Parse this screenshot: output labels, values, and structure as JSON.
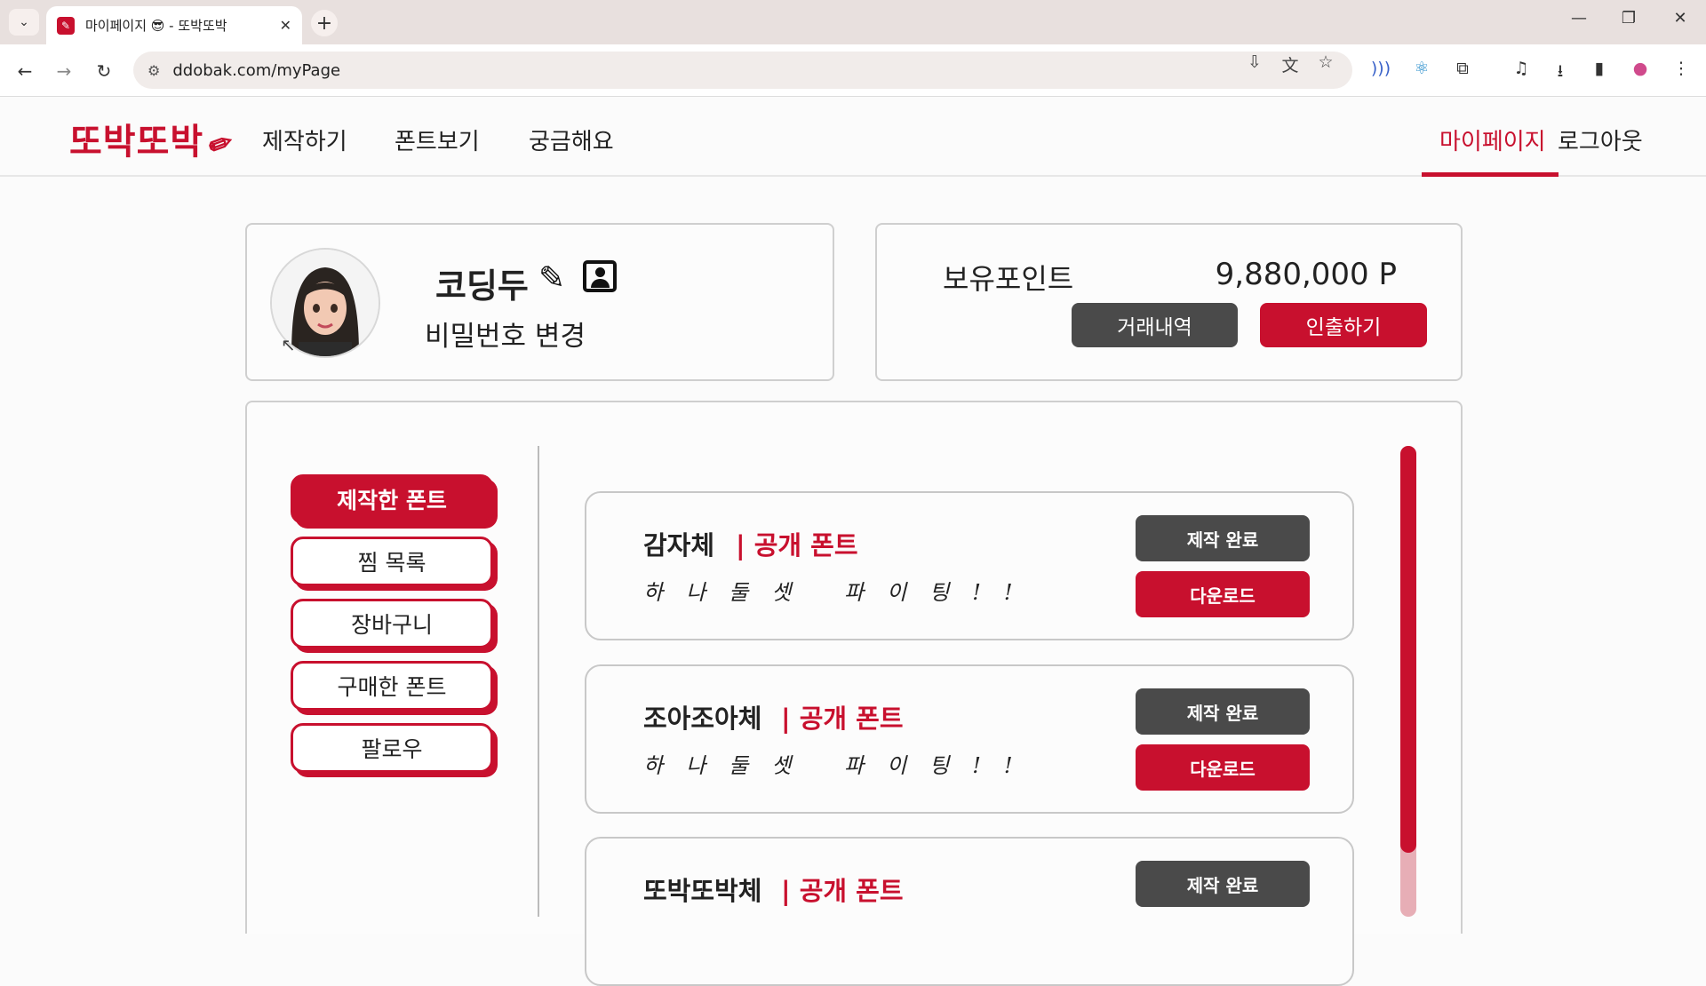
{
  "browser": {
    "tab_title": "마이페이지 😎 - 또박또박",
    "url_display": "ddobak.com/myPage",
    "icons": {
      "tab_search": "chevron-down-icon",
      "new_tab": "plus-icon",
      "close_tab": "close-icon",
      "back": "back-arrow-icon",
      "forward": "forward-arrow-icon",
      "reload": "reload-icon"
    }
  },
  "header": {
    "logo": "또박또박",
    "nav": [
      "제작하기",
      "폰트보기",
      "궁금해요"
    ],
    "mypage": "마이페이지",
    "logout": "로그아웃",
    "accent_color": "#c8102e"
  },
  "profile": {
    "nickname": "코딩두",
    "password_change": "비밀번호 변경"
  },
  "points": {
    "label": "보유포인트",
    "value": "9,880,000 P",
    "history_button": "거래내역",
    "withdraw_button": "인출하기"
  },
  "sidebar": {
    "items": [
      {
        "label": "제작한 폰트",
        "active": true
      },
      {
        "label": "찜 목록",
        "active": false
      },
      {
        "label": "장바구니",
        "active": false
      },
      {
        "label": "구매한 폰트",
        "active": false
      },
      {
        "label": "팔로우",
        "active": false
      }
    ]
  },
  "fonts": [
    {
      "name": "감자체",
      "tag": "| 공개 폰트",
      "sample": "하나둘셋 파이팅!!",
      "status_button": "제작 완료",
      "download_button": "다운로드"
    },
    {
      "name": "조아조아체",
      "tag": "| 공개 폰트",
      "sample": "하나둘셋 파이팅!!",
      "status_button": "제작 완료",
      "download_button": "다운로드"
    },
    {
      "name": "또박또박체",
      "tag": "| 공개 폰트",
      "status_button": "제작 완료"
    }
  ]
}
